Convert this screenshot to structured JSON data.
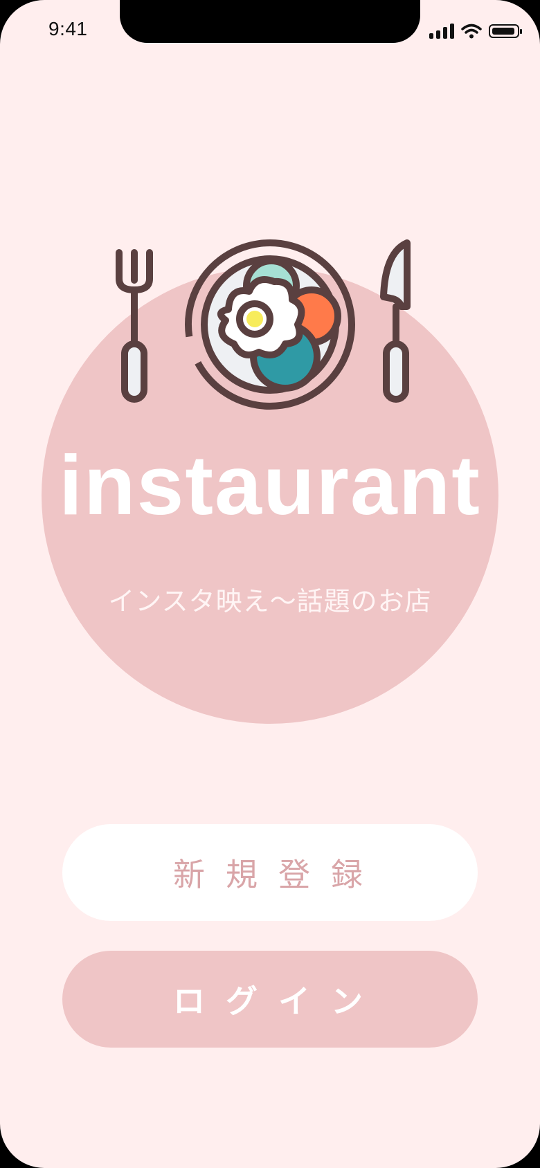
{
  "status_bar": {
    "time": "9:41",
    "icons": [
      "cellular-signal-icon",
      "wifi-icon",
      "battery-icon"
    ]
  },
  "brand": {
    "logo_icon": "plate-with-fork-and-knife-icon",
    "title": "instaurant",
    "subtitle": "インスタ映え〜話題のお店"
  },
  "actions": {
    "register_label": "新規登録",
    "login_label": "ログイン"
  },
  "colors": {
    "background": "#ffeeee",
    "accent_pink": "#efc5c6",
    "register_text": "#d9a5a8",
    "icon_stroke": "#5a4040",
    "mint": "#a6e0d4",
    "orange": "#ff7a4a",
    "teal": "#2f9aa5",
    "yolk": "#f7ec5c"
  }
}
